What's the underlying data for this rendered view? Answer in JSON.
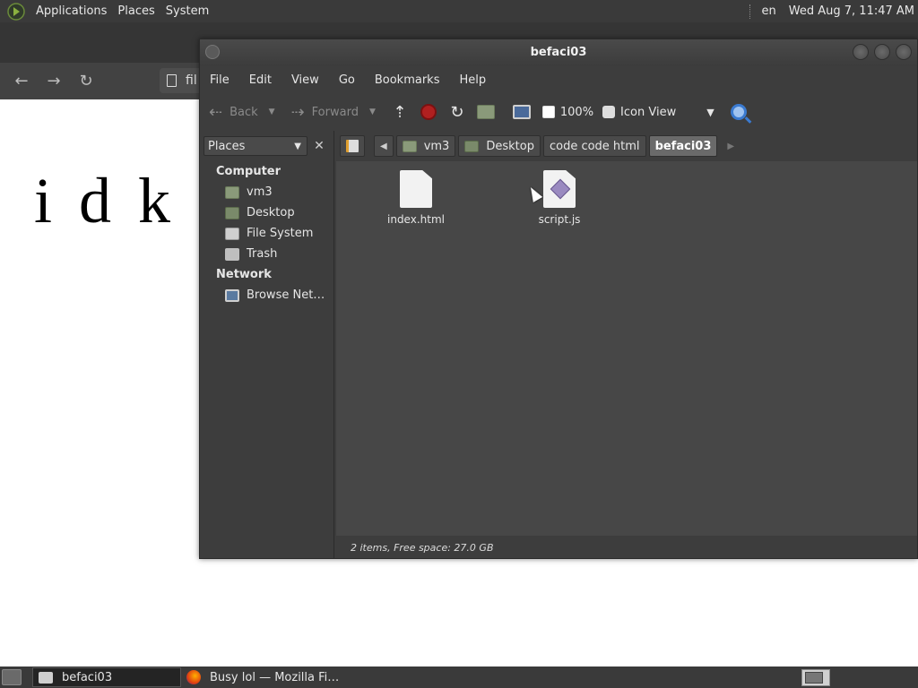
{
  "top_panel": {
    "menus": [
      "Applications",
      "Places",
      "System"
    ],
    "language": "en",
    "clock": "Wed Aug  7, 11:47 AM"
  },
  "browser": {
    "url_partial": "fil",
    "page_text": "i d k"
  },
  "file_manager": {
    "title": "befaci03",
    "menu": [
      "File",
      "Edit",
      "View",
      "Go",
      "Bookmarks",
      "Help"
    ],
    "toolbar": {
      "back": "Back",
      "forward": "Forward",
      "zoom": "100%",
      "view_mode": "Icon View"
    },
    "sidebar": {
      "combo": "Places",
      "sections": [
        {
          "title": "Computer",
          "items": [
            "vm3",
            "Desktop",
            "File System",
            "Trash"
          ]
        },
        {
          "title": "Network",
          "items": [
            "Browse Net…"
          ]
        }
      ]
    },
    "breadcrumbs": [
      "vm3",
      "Desktop",
      "code code html",
      "befaci03"
    ],
    "files": [
      {
        "name": "index.html",
        "type": "html"
      },
      {
        "name": "script.js",
        "type": "js"
      }
    ],
    "status": "2 items, Free space: 27.0 GB"
  },
  "taskbar": {
    "tasks": [
      "befaci03",
      "Busy lol — Mozilla Fi…"
    ]
  }
}
